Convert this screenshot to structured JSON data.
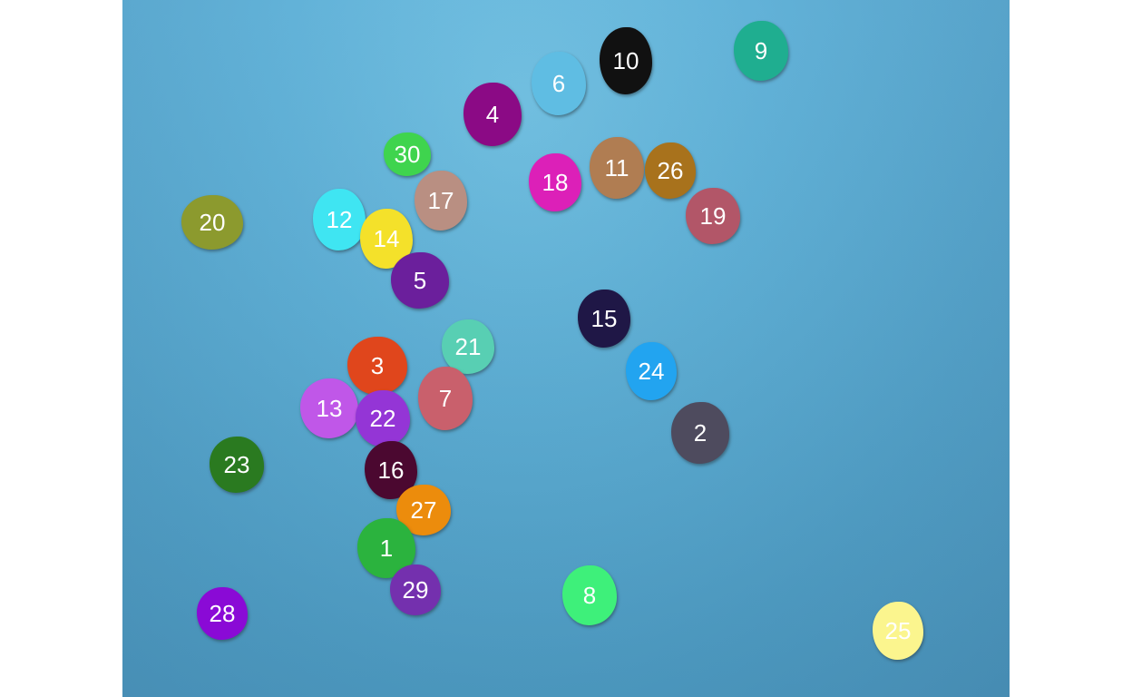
{
  "blobs": [
    {
      "label": "1",
      "color": "#2bb33e"
    },
    {
      "label": "2",
      "color": "#4e4b5e"
    },
    {
      "label": "3",
      "color": "#e0461c"
    },
    {
      "label": "4",
      "color": "#8b0a85"
    },
    {
      "label": "5",
      "color": "#6b1f9c"
    },
    {
      "label": "6",
      "color": "#5fbde3"
    },
    {
      "label": "7",
      "color": "#c9606c"
    },
    {
      "label": "8",
      "color": "#3ef07a"
    },
    {
      "label": "9",
      "color": "#1fae90"
    },
    {
      "label": "10",
      "color": "#111111"
    },
    {
      "label": "11",
      "color": "#b07d52"
    },
    {
      "label": "12",
      "color": "#3fe5f2"
    },
    {
      "label": "13",
      "color": "#c057e8"
    },
    {
      "label": "14",
      "color": "#f4e12a"
    },
    {
      "label": "15",
      "color": "#1f1746"
    },
    {
      "label": "16",
      "color": "#4b0830"
    },
    {
      "label": "17",
      "color": "#b98f82"
    },
    {
      "label": "18",
      "color": "#dc20b8"
    },
    {
      "label": "19",
      "color": "#b25668"
    },
    {
      "label": "20",
      "color": "#8c9a2e"
    },
    {
      "label": "21",
      "color": "#58cfb3"
    },
    {
      "label": "22",
      "color": "#9435d6"
    },
    {
      "label": "23",
      "color": "#2a7a20"
    },
    {
      "label": "24",
      "color": "#22a4f0"
    },
    {
      "label": "25",
      "color": "#fbf58e"
    },
    {
      "label": "26",
      "color": "#a8721c"
    },
    {
      "label": "27",
      "color": "#ec8c0c"
    },
    {
      "label": "28",
      "color": "#8a0ad6"
    },
    {
      "label": "29",
      "color": "#7430ae"
    },
    {
      "label": "30",
      "color": "#3fd44e"
    }
  ]
}
